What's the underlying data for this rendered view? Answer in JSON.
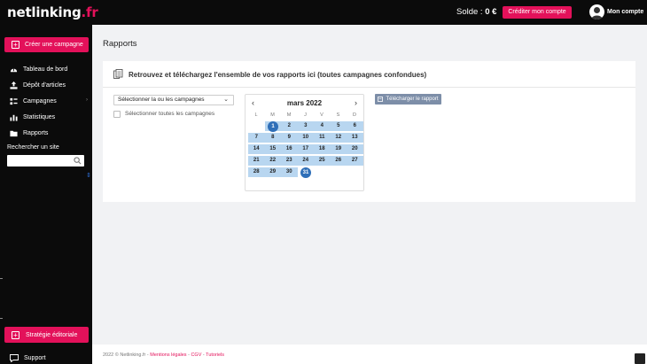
{
  "brand": {
    "name": "netlinking",
    "tld": ".fr"
  },
  "header": {
    "balance_label": "Solde : ",
    "balance_value": "0 €",
    "credit_button": "Créditer mon compte",
    "account_label": "Mon compte"
  },
  "sidebar": {
    "create_button": "Créer une campagne",
    "items": [
      {
        "label": "Tableau de bord",
        "icon": "dashboard-icon"
      },
      {
        "label": "Dépôt d'articles",
        "icon": "upload-icon"
      },
      {
        "label": "Campagnes",
        "icon": "campaigns-icon",
        "chevron": "›"
      },
      {
        "label": "Statistiques",
        "icon": "stats-icon"
      },
      {
        "label": "Rapports",
        "icon": "folder-icon"
      }
    ],
    "search_label": "Rechercher un site",
    "search_placeholder": "",
    "strategy_button": "Stratégie éditoriale",
    "support": "Support"
  },
  "main": {
    "page_title": "Rapports",
    "card_title": "Retrouvez et téléchargez l'ensemble de vos rapports ici (toutes campagnes confondues)",
    "campaign_select": "Sélectionner la ou les campagnes",
    "select_all": "Sélectionner toutes les campagnes",
    "download_button": "Télécharger le rapport"
  },
  "calendar": {
    "month": "mars 2022",
    "prev": "‹",
    "next": "›",
    "weekdays": [
      "L",
      "M",
      "M",
      "J",
      "V",
      "S",
      "D"
    ],
    "weeks": [
      [
        "",
        "1",
        "2",
        "3",
        "4",
        "5",
        "6"
      ],
      [
        "7",
        "8",
        "9",
        "10",
        "11",
        "12",
        "13"
      ],
      [
        "14",
        "15",
        "16",
        "17",
        "18",
        "19",
        "20"
      ],
      [
        "21",
        "22",
        "23",
        "24",
        "25",
        "26",
        "27"
      ],
      [
        "28",
        "29",
        "30",
        "31",
        "",
        "",
        ""
      ]
    ],
    "range_start": "1",
    "range_end": "31"
  },
  "footer": {
    "copyright": "2022 © Netlinking.fr",
    "separator": " - ",
    "links": [
      "Mentions légales",
      "CGV",
      "Tutoriels"
    ]
  },
  "colors": {
    "accent": "#e3115a",
    "range": "#b8d6f0",
    "selected": "#2f6fb8",
    "button_grey": "#7d8ea8"
  }
}
